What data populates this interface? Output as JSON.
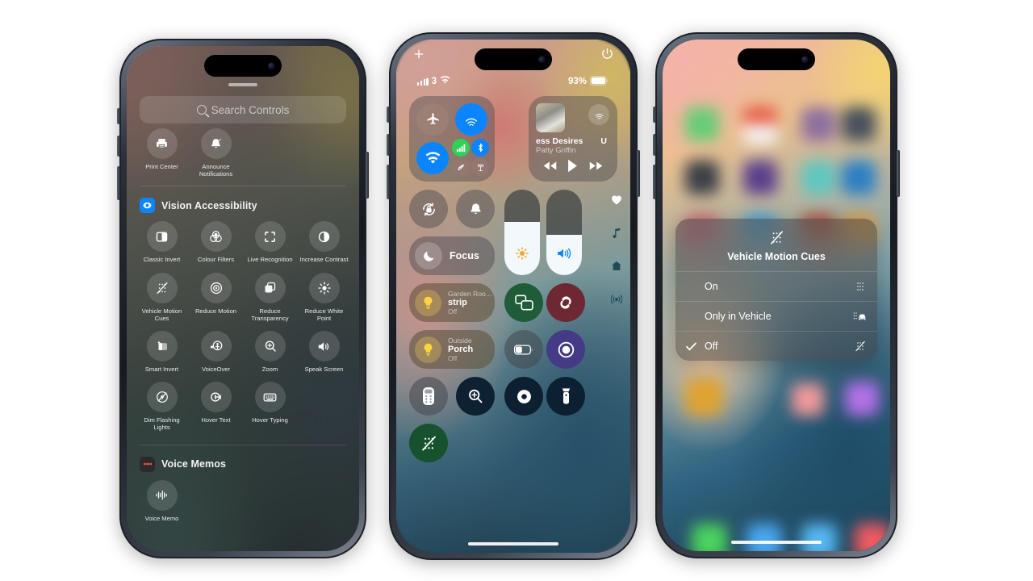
{
  "background_color": "#ffffff",
  "phone1": {
    "name": "controls-gallery",
    "search": {
      "placeholder": "Search Controls",
      "icon": "search-icon"
    },
    "sections": [
      {
        "header": null,
        "controls": [
          {
            "label": "Print Center",
            "icon": "printer-icon"
          },
          {
            "label": "Announce Notifications",
            "icon": "bell-icon"
          }
        ]
      },
      {
        "header": {
          "title": "Vision Accessibility",
          "icon": "eye-icon",
          "color": "#0a84ff"
        },
        "controls": [
          {
            "label": "Classic Invert",
            "icon": "classic-invert-icon"
          },
          {
            "label": "Colour Filters",
            "icon": "colour-filters-icon"
          },
          {
            "label": "Live Recognition",
            "icon": "live-recognition-icon"
          },
          {
            "label": "Increase Contrast",
            "icon": "increase-contrast-icon"
          },
          {
            "label": "Vehicle Motion Cues",
            "icon": "vehicle-motion-cues-icon"
          },
          {
            "label": "Reduce Motion",
            "icon": "reduce-motion-icon"
          },
          {
            "label": "Reduce Transparency",
            "icon": "reduce-transparency-icon"
          },
          {
            "label": "Reduce White Point",
            "icon": "reduce-white-point-icon"
          },
          {
            "label": "Smart Invert",
            "icon": "smart-invert-icon"
          },
          {
            "label": "VoiceOver",
            "icon": "voiceover-icon"
          },
          {
            "label": "Zoom",
            "icon": "zoom-icon"
          },
          {
            "label": "Speak Screen",
            "icon": "speak-screen-icon"
          },
          {
            "label": "Dim Flashing Lights",
            "icon": "dim-flashing-lights-icon"
          },
          {
            "label": "Hover Text",
            "icon": "hover-text-icon"
          },
          {
            "label": "Hover Typing",
            "icon": "hover-typing-icon"
          }
        ]
      },
      {
        "header": {
          "title": "Voice Memos",
          "icon": "voice-memos-icon",
          "color": "#2b2b2e"
        },
        "controls": [
          {
            "label": "Voice Memo",
            "icon": "waveform-icon"
          }
        ]
      }
    ]
  },
  "phone2": {
    "name": "control-center",
    "top": {
      "add_label": "+",
      "add_icon": "plus-icon",
      "power_icon": "power-icon"
    },
    "status_bar": {
      "signal_icon": "cellular-bars-icon",
      "carrier_count": "3",
      "wifi_icon": "wifi-icon",
      "battery_percent": "93%",
      "battery_icon": "battery-icon"
    },
    "connectivity": {
      "airplane": {
        "label": "Airplane Mode",
        "icon": "airplane-icon",
        "state": "off"
      },
      "airdrop": {
        "label": "AirDrop",
        "icon": "airdrop-icon",
        "state": "on",
        "color": "#0a84ff"
      },
      "wifi": {
        "label": "Wi-Fi",
        "icon": "wifi-icon",
        "state": "on",
        "color": "#0a84ff"
      },
      "cellular": {
        "label": "Cellular Data",
        "icon": "cellular-icon",
        "state": "on",
        "color": "#30d158"
      },
      "bluetooth": {
        "label": "Bluetooth",
        "icon": "bluetooth-icon",
        "state": "on",
        "color": "#0a84ff"
      },
      "satellite": {
        "label": "Satellite",
        "icon": "satellite-icon",
        "state": "off"
      },
      "hotspot": {
        "label": "Personal Hotspot",
        "icon": "hotspot-icon",
        "state": "off"
      }
    },
    "media": {
      "title": "ess Desires",
      "artist": "Patty Griffin",
      "next_fragment": "U",
      "airplay_icon": "airplay-icon",
      "rewind_icon": "rewind-icon",
      "play_icon": "play-icon",
      "forward_icon": "fast-forward-icon"
    },
    "quick": {
      "rotation_lock": {
        "label": "Rotation Lock",
        "icon": "rotation-lock-icon"
      },
      "silent_mode": {
        "label": "Silent Mode",
        "icon": "bell-icon"
      },
      "focus": {
        "label": "Focus",
        "icon": "moon-icon"
      }
    },
    "sliders": {
      "brightness": {
        "label": "Brightness",
        "icon": "sun-icon",
        "value": 62
      },
      "volume": {
        "label": "Volume",
        "icon": "speaker-icon",
        "value": 47
      }
    },
    "page_dots": [
      {
        "name": "favorites",
        "icon": "heart-icon",
        "active": true
      },
      {
        "name": "now-playing",
        "icon": "music-note-icon",
        "active": false
      },
      {
        "name": "home",
        "icon": "home-icon",
        "active": false
      },
      {
        "name": "connectivity",
        "icon": "broadcast-icon",
        "active": false
      }
    ],
    "home_tiles": [
      {
        "room": "Garden Roo...",
        "name": "strip",
        "state": "Off",
        "icon": "lightbulb-icon"
      },
      {
        "room": "Outside",
        "name": "Porch",
        "state": "Off",
        "icon": "lightbulb-icon"
      }
    ],
    "buttons": [
      {
        "label": "Screen Mirroring",
        "icon": "screen-mirroring-icon",
        "color": "#1f5c38"
      },
      {
        "label": "Shazam",
        "icon": "shazam-icon",
        "color": "#6e2833"
      },
      {
        "label": "Low Power Mode",
        "icon": "low-power-icon",
        "color": "#46484e"
      },
      {
        "label": "Screen Recording",
        "icon": "screen-record-icon",
        "color": "#453a86"
      },
      {
        "label": "Apple TV Remote",
        "icon": "remote-icon",
        "color": "#46484e"
      },
      {
        "label": "Magnifier",
        "icon": "magnifier-icon",
        "color": "#0e2133"
      },
      {
        "label": "Dark Mode",
        "icon": "dark-mode-icon",
        "color": "#0d2031"
      },
      {
        "label": "Flashlight",
        "icon": "flashlight-icon",
        "color": "#0d2031"
      },
      {
        "label": "Vehicle Motion Cues",
        "icon": "vehicle-motion-cues-icon",
        "color": "#17522f"
      }
    ]
  },
  "phone3": {
    "name": "vehicle-motion-cues-popup",
    "popup": {
      "title": "Vehicle Motion Cues",
      "icon": "vehicle-motion-cues-icon",
      "options": [
        {
          "label": "On",
          "icon": "motion-dots-icon",
          "selected": false
        },
        {
          "label": "Only in Vehicle",
          "icon": "car-dots-icon",
          "selected": false
        },
        {
          "label": "Off",
          "icon": "motion-dots-off-icon",
          "selected": true
        }
      ],
      "checkmark": "✓"
    }
  }
}
